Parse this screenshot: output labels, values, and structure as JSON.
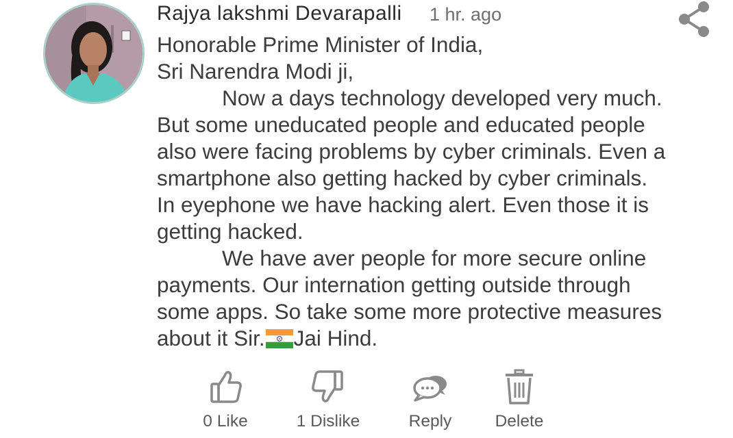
{
  "comment": {
    "author": "Rajya lakshmi Devarapalli",
    "timestamp": "1 hr. ago",
    "avatar_icon": "user-photo",
    "share_icon": "share-icon",
    "body_lines": [
      "Honorable Prime Minister of India,",
      "Sri Narendra Modi ji,",
      "Now a days technology developed very much.",
      "But some uneducated people and educated people",
      "also were facing problems by cyber criminals. Even a",
      "smartphone also getting hacked by cyber criminals.",
      "In eyephone we have hacking alert. Even those it is",
      "getting hacked.",
      "We have aver people for more secure online",
      "payments. Our internation getting outside through",
      "some apps. So take some more protective measures",
      "about it Sir."
    ],
    "body_last_suffix": "Jai Hind.",
    "flag_icon": "india-flag-icon"
  },
  "actions": {
    "like": {
      "count": "0",
      "label": "Like",
      "icon": "thumbs-up-icon"
    },
    "dislike": {
      "count": "1",
      "label": "Dislike",
      "icon": "thumbs-down-icon"
    },
    "reply": {
      "label": "Reply",
      "icon": "chat-bubbles-icon"
    },
    "delete": {
      "label": "Delete",
      "icon": "trash-icon"
    }
  },
  "colors": {
    "text_primary": "#2b2b2b",
    "text_body": "#3c3c3c",
    "text_secondary": "#6e6e6e",
    "icon_gray": "#8a8a8a",
    "avatar_ring": "#a8d0c8",
    "flag_saffron": "#f59a32",
    "flag_green": "#3a9a3c",
    "flag_chakra": "#1f3f8f"
  }
}
